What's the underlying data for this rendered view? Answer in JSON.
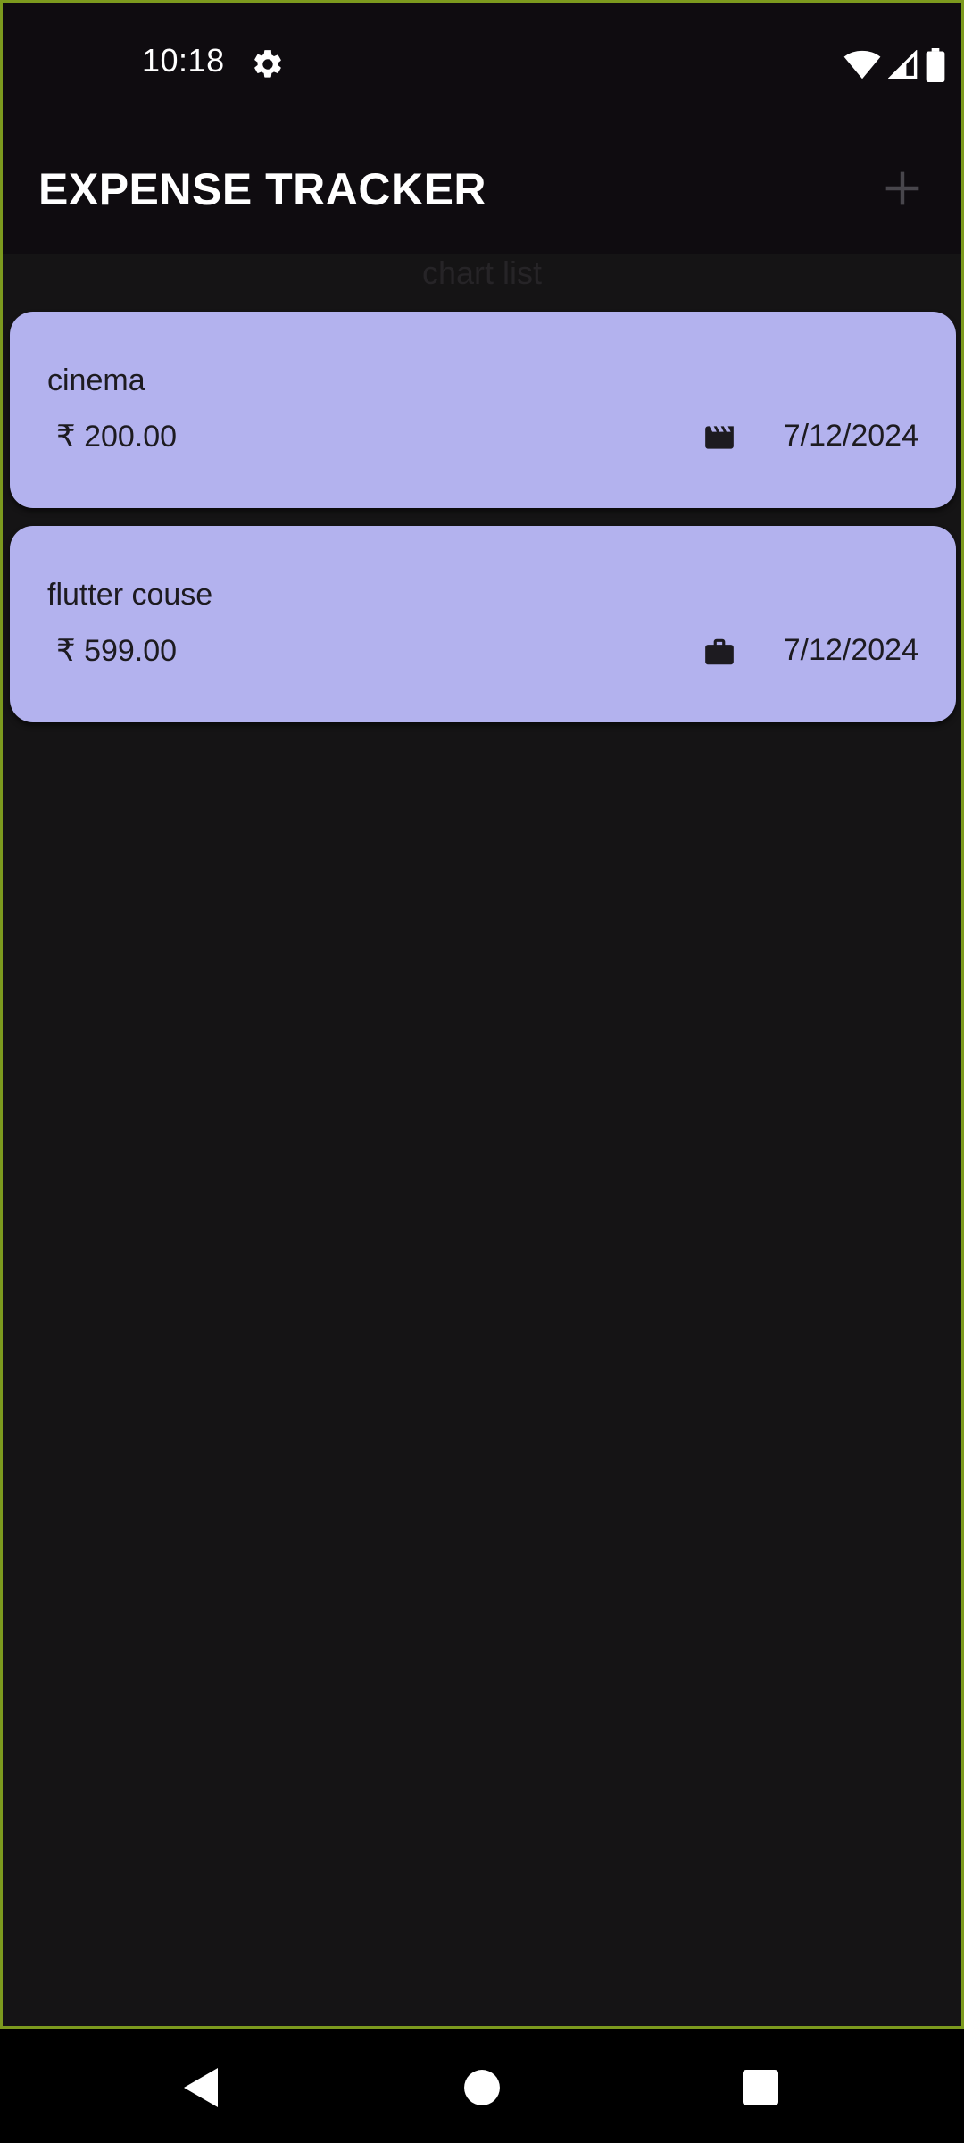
{
  "status_bar": {
    "time": "10:18",
    "icons": [
      "settings-icon",
      "wifi-icon",
      "signal-icon",
      "battery-icon"
    ]
  },
  "app_bar": {
    "title": "EXPENSE TRACKER",
    "add_icon": "plus-icon"
  },
  "chart_label": "chart list",
  "expenses": [
    {
      "title": "cinema",
      "amount": "₹ 200.00",
      "category_icon": "movie-clapper-icon",
      "date": "7/12/2024"
    },
    {
      "title": "flutter couse",
      "amount": "₹ 599.00",
      "category_icon": "briefcase-icon",
      "date": "7/12/2024"
    }
  ],
  "nav_bar": {
    "items": [
      "back-icon",
      "home-icon",
      "recents-icon"
    ]
  },
  "colors": {
    "background": "#151415",
    "app_bar": "#0f0c10",
    "card": "#b3b2ee",
    "card_text": "#1d1b20",
    "frame_border": "#7c9a1e"
  }
}
